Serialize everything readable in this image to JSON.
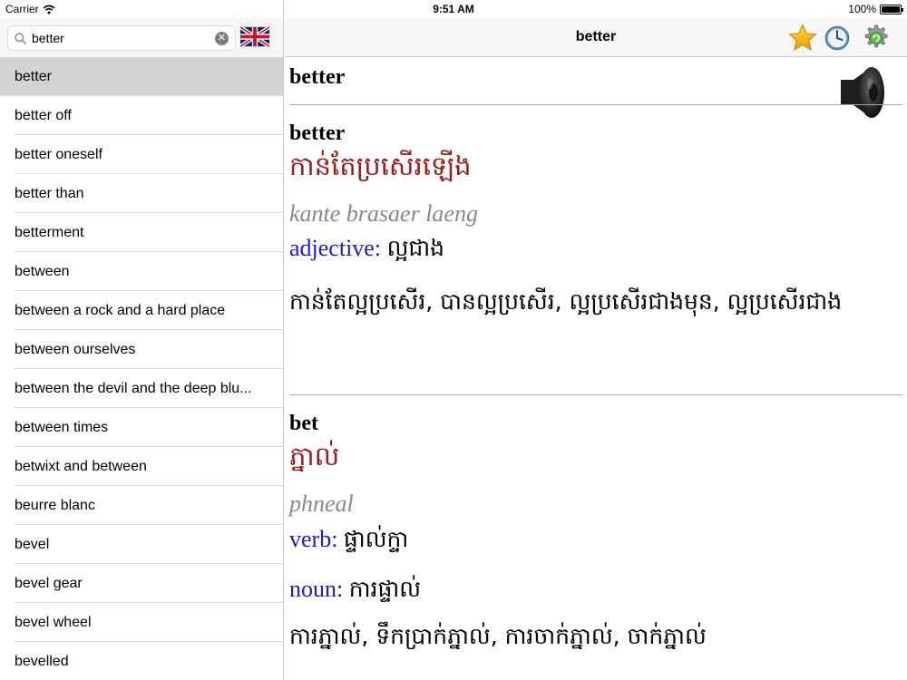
{
  "status": {
    "carrier": "Carrier",
    "time": "9:51 AM",
    "battery": "100%",
    "battery_level": 1.0
  },
  "search": {
    "value": "better",
    "placeholder": ""
  },
  "word_list": [
    "better",
    "better off",
    "better oneself",
    "better than",
    "betterment",
    "between",
    "between a rock and a hard place",
    "between ourselves",
    "between the devil and the deep blu...",
    "between times",
    "betwixt and between",
    "beurre blanc",
    "bevel",
    "bevel gear",
    "bevel wheel",
    "bevelled"
  ],
  "selected_index": 0,
  "nav": {
    "title": "better"
  },
  "entry": {
    "heading": "better"
  },
  "definitions": [
    {
      "word": "better",
      "khmer": "កាន់តែប្រសើរឡើង",
      "translit": "kante brasaer laeng",
      "senses": [
        {
          "pos": "adjective:",
          "text": "ល្អជាង"
        }
      ],
      "synonyms": "កាន់តែល្អប្រសើរ, បានល្អប្រសើរ, ល្អប្រសើរជាងមុន, ល្អប្រសើរជាង"
    },
    {
      "word": "bet",
      "khmer": "ភ្នាល់",
      "translit": "phneal",
      "senses": [
        {
          "pos": "verb:",
          "text": "ផ្ទាល់ក្ទា"
        },
        {
          "pos": "noun:",
          "text": "ការផ្ទាល់"
        }
      ],
      "synonyms": "ការភ្នាល់, ទឹកប្រាក់ភ្នាល់, ការចាក់ភ្នាល់, ចាក់ភ្នាល់"
    }
  ],
  "colors": {
    "khmer_red": "#9e1b1b",
    "pos_blue": "#1a1ad6",
    "translit_gray": "#888888",
    "selected_row": "#d3d3d3"
  },
  "icons": [
    "magnifier-icon",
    "clear-icon",
    "uk-flag-icon",
    "star-icon",
    "history-clock-icon",
    "settings-gear-icon",
    "speaker-icon",
    "wifi-icon",
    "battery-icon"
  ]
}
